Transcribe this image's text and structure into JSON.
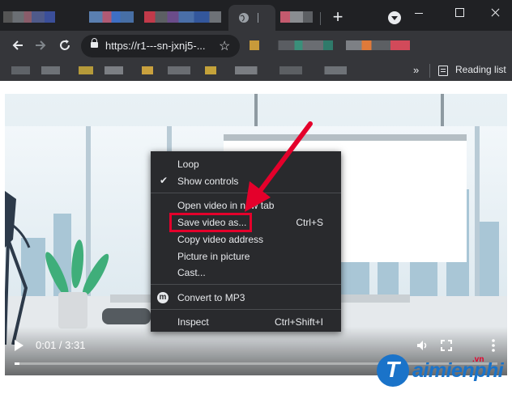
{
  "browser": {
    "address_url": "https://r1---sn-jxnj5-...",
    "reading_list_label": "Reading list",
    "bookmarks_more": "»",
    "new_tab_symbol": "+"
  },
  "video": {
    "time_display": "0:01 / 3:31",
    "progress_fraction": 0.0047
  },
  "context_menu": {
    "items": [
      {
        "label": "Loop",
        "checked": false,
        "shortcut": ""
      },
      {
        "label": "Show controls",
        "checked": true,
        "shortcut": ""
      },
      {
        "label": "Open video in new tab",
        "shortcut": ""
      },
      {
        "label": "Save video as...",
        "shortcut": "Ctrl+S"
      },
      {
        "label": "Copy video address",
        "shortcut": ""
      },
      {
        "label": "Picture in picture",
        "shortcut": ""
      },
      {
        "label": "Cast...",
        "shortcut": ""
      },
      {
        "label": "Convert to MP3",
        "shortcut": "",
        "icon_letter": "m"
      },
      {
        "label": "Inspect",
        "shortcut": "Ctrl+Shift+I"
      }
    ]
  },
  "annotation": {
    "highlight_color": "#e4002b",
    "arrow_color": "#e4002b"
  },
  "watermark": {
    "brand": "aimienphi",
    "logo_letter": "T",
    "suffix": ".vn"
  },
  "colors": {
    "chrome_dark": "#202124",
    "toolbar": "#35363a",
    "menu_bg": "#292a2d",
    "brand_blue": "#1a73c9"
  }
}
